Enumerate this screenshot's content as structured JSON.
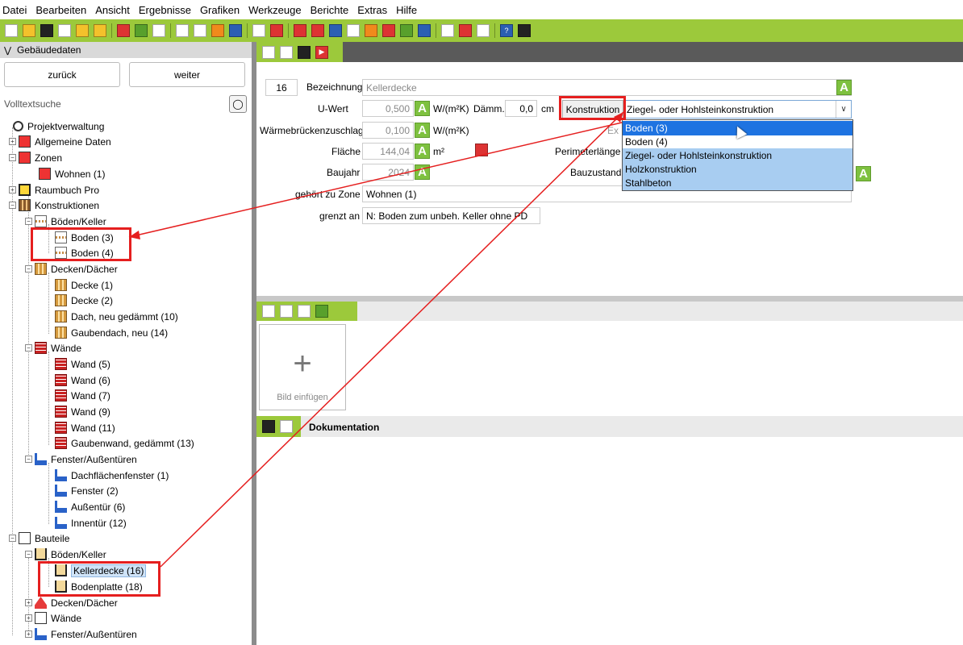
{
  "menubar": [
    "Datei",
    "Bearbeiten",
    "Ansicht",
    "Ergebnisse",
    "Grafiken",
    "Werkzeuge",
    "Berichte",
    "Extras",
    "Hilfe"
  ],
  "colors": {
    "accent_green": "#9cc93b",
    "highlight_blue": "#1e73e1",
    "alt_blue": "#a8cdf1",
    "annotation_red": "#e51f1f",
    "badge_green": "#7ec13f"
  },
  "left": {
    "header": "Gebäudedaten",
    "back": "zurück",
    "next": "weiter",
    "fulltext": "Volltextsuche",
    "tree": [
      {
        "label": "Projektverwaltung"
      },
      {
        "label": "Allgemeine Daten"
      },
      {
        "label": "Zonen"
      },
      {
        "label": "Wohnen (1)"
      },
      {
        "label": "Raumbuch Pro"
      },
      {
        "label": "Konstruktionen"
      },
      {
        "label": "Böden/Keller"
      },
      {
        "label": "Boden (3)"
      },
      {
        "label": "Boden (4)"
      },
      {
        "label": "Decken/Dächer"
      },
      {
        "label": "Decke (1)"
      },
      {
        "label": "Decke (2)"
      },
      {
        "label": "Dach, neu gedämmt (10)"
      },
      {
        "label": "Gaubendach, neu (14)"
      },
      {
        "label": "Wände"
      },
      {
        "label": "Wand (5)"
      },
      {
        "label": "Wand (6)"
      },
      {
        "label": "Wand (7)"
      },
      {
        "label": "Wand (9)"
      },
      {
        "label": "Wand (11)"
      },
      {
        "label": "Gaubenwand, gedämmt (13)"
      },
      {
        "label": "Fenster/Außentüren"
      },
      {
        "label": "Dachflächenfenster (1)"
      },
      {
        "label": "Fenster (2)"
      },
      {
        "label": "Außentür (6)"
      },
      {
        "label": "Innentür (12)"
      },
      {
        "label": "Bauteile"
      },
      {
        "label": "Böden/Keller"
      },
      {
        "label": "Kellerdecke (16)"
      },
      {
        "label": "Bodenplatte (18)"
      },
      {
        "label": "Decken/Dächer"
      },
      {
        "label": "Wände"
      },
      {
        "label": "Fenster/Außentüren"
      }
    ]
  },
  "form": {
    "number": "16",
    "bez_label": "Bezeichnung",
    "bez_value": "Kellerdecke",
    "uwert_label": "U-Wert",
    "uwert_value": "0,500",
    "uwert_unit": "W/(m²K)",
    "daemm_label": "Dämm.",
    "daemm_value": "0,0",
    "daemm_unit": "cm",
    "kon_label": "Konstruktion",
    "kon_value": "Ziegel- oder Hohlsteinkonstruktion",
    "wbz_label": "Wärmebrückenzuschlag",
    "wbz_value": "0,100",
    "wbz_unit": "W/(m²K)",
    "flaeche_label": "Fläche",
    "flaeche_value": "144,04",
    "flaeche_unit": "m²",
    "perimeter_label": "Perimeterlänge",
    "baujahr_label": "Baujahr",
    "baujahr_value": "2024",
    "bauzustand_label": "Bauzustand",
    "zone_label": "gehört zu Zone",
    "zone_value": "Wohnen (1)",
    "grenzt_label": "grenzt an",
    "grenzt_value": "N: Boden zum unbeh. Keller ohne PD",
    "badge": "A",
    "obscured_text": "Ex"
  },
  "dropdown": [
    "Boden (3)",
    "Boden (4)",
    "Ziegel- oder Hohlsteinkonstruktion",
    "Holzkonstruktion",
    "Stahlbeton"
  ],
  "images": {
    "add_label": "Bild einfügen",
    "plus": "+"
  },
  "doc": {
    "title": "Dokumentation"
  }
}
